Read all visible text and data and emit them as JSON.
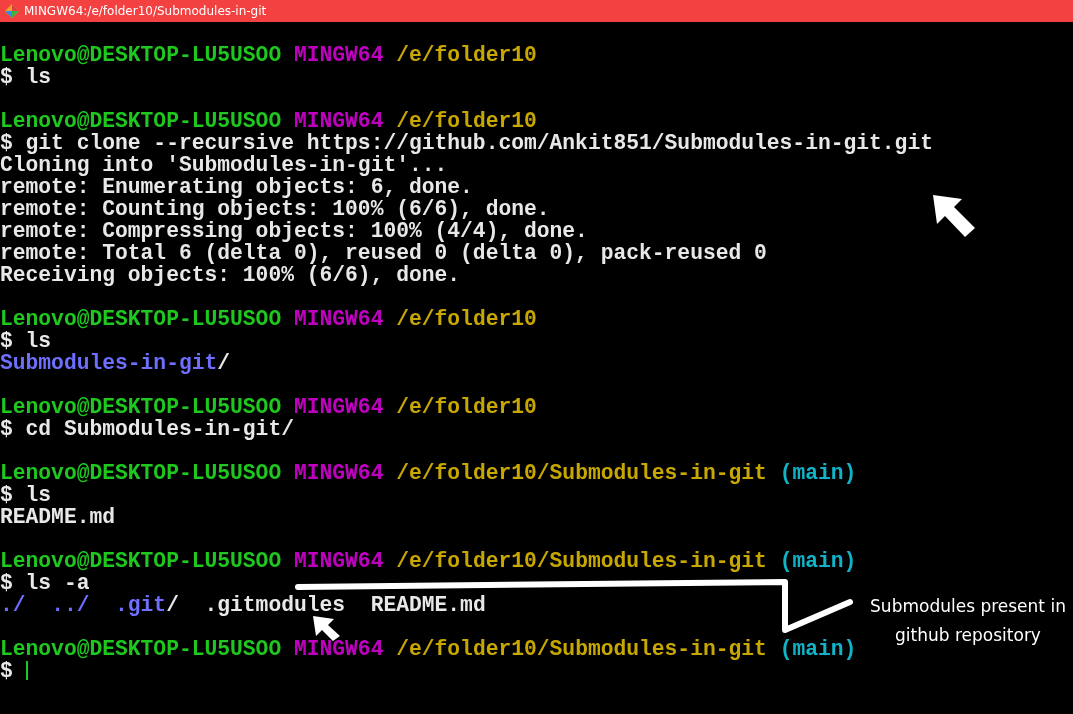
{
  "window": {
    "title": "MINGW64:/e/folder10/Submodules-in-git"
  },
  "terminal": {
    "lines": [
      {
        "kind": "prompt",
        "user_host": "Lenovo@DESKTOP-LU5USOO",
        "shell": "MINGW64",
        "path": "/e/folder10"
      },
      {
        "kind": "command",
        "text": "$ ls"
      },
      {
        "kind": "blank"
      },
      {
        "kind": "prompt",
        "user_host": "Lenovo@DESKTOP-LU5USOO",
        "shell": "MINGW64",
        "path": "/e/folder10"
      },
      {
        "kind": "command",
        "text": "$ git clone --recursive https://github.com/Ankit851/Submodules-in-git.git"
      },
      {
        "kind": "output",
        "segments": [
          {
            "text": "Cloning into 'Submodules-in-git'...",
            "color": "#e8e8e8"
          }
        ]
      },
      {
        "kind": "output",
        "segments": [
          {
            "text": "remote: Enumerating objects: 6, done.",
            "color": "#e8e8e8"
          }
        ]
      },
      {
        "kind": "output",
        "segments": [
          {
            "text": "remote: Counting objects: 100% (6/6), done.",
            "color": "#e8e8e8"
          }
        ]
      },
      {
        "kind": "output",
        "segments": [
          {
            "text": "remote: Compressing objects: 100% (4/4), done.",
            "color": "#e8e8e8"
          }
        ]
      },
      {
        "kind": "output",
        "segments": [
          {
            "text": "remote: Total 6 (delta 0), reused 0 (delta 0), pack-reused 0",
            "color": "#e8e8e8"
          }
        ]
      },
      {
        "kind": "output",
        "segments": [
          {
            "text": "Receiving objects: 100% (6/6), done.",
            "color": "#e8e8e8"
          }
        ]
      },
      {
        "kind": "blank"
      },
      {
        "kind": "prompt",
        "user_host": "Lenovo@DESKTOP-LU5USOO",
        "shell": "MINGW64",
        "path": "/e/folder10"
      },
      {
        "kind": "command",
        "text": "$ ls"
      },
      {
        "kind": "output",
        "segments": [
          {
            "text": "Submodules-in-git",
            "color": "#6e6eff"
          },
          {
            "text": "/",
            "color": "#e8e8e8"
          }
        ]
      },
      {
        "kind": "blank"
      },
      {
        "kind": "prompt",
        "user_host": "Lenovo@DESKTOP-LU5USOO",
        "shell": "MINGW64",
        "path": "/e/folder10"
      },
      {
        "kind": "command",
        "text": "$ cd Submodules-in-git/"
      },
      {
        "kind": "blank"
      },
      {
        "kind": "prompt",
        "user_host": "Lenovo@DESKTOP-LU5USOO",
        "shell": "MINGW64",
        "path": "/e/folder10/Submodules-in-git",
        "branch": "(main)"
      },
      {
        "kind": "command",
        "text": "$ ls"
      },
      {
        "kind": "output",
        "segments": [
          {
            "text": "README.md",
            "color": "#e8e8e8"
          }
        ]
      },
      {
        "kind": "blank"
      },
      {
        "kind": "prompt",
        "user_host": "Lenovo@DESKTOP-LU5USOO",
        "shell": "MINGW64",
        "path": "/e/folder10/Submodules-in-git",
        "branch": "(main)"
      },
      {
        "kind": "command",
        "text": "$ ls -a"
      },
      {
        "kind": "output",
        "segments": [
          {
            "text": "./",
            "color": "#6e6eff"
          },
          {
            "text": "../",
            "color": "#6e6eff"
          },
          {
            "text": ".git",
            "color": "#6e6eff"
          },
          {
            "text": "/",
            "color": "#e8e8e8"
          },
          {
            "text": ".gitmodules",
            "color": "#e8e8e8"
          },
          {
            "text": "README.md",
            "color": "#e8e8e8"
          }
        ]
      },
      {
        "kind": "blank"
      },
      {
        "kind": "prompt",
        "user_host": "Lenovo@DESKTOP-LU5USOO",
        "shell": "MINGW64",
        "path": "/e/folder10/Submodules-in-git",
        "branch": "(main)"
      },
      {
        "kind": "input",
        "text": "$"
      }
    ]
  },
  "annotation": {
    "text": "Submodules present in github repository"
  }
}
